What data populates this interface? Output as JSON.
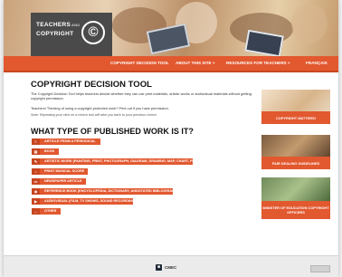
{
  "logo": {
    "line1": "TEACHERS",
    "and": "AND",
    "line2": "COPYRIGHT",
    "symbol": "©"
  },
  "nav": {
    "items": [
      {
        "label": "COPYRIGHT DECISION TOOL"
      },
      {
        "label": "ABOUT THIS SITE +"
      },
      {
        "label": "RESOURCES FOR TEACHERS +"
      },
      {
        "label": "FRANÇAIS"
      }
    ]
  },
  "main": {
    "title": "COPYRIGHT DECISION TOOL",
    "intro": "The Copyright Decision Tool helps teachers decide whether they can use print materials, artistic works or audiovisual materials without getting copyright permission.",
    "ask": "Teachers! Thinking of using a copyright-protected work? Print out if you have permission.",
    "note": "Note: Repeating your click on a choice tool will take you back to your previous choice.",
    "question": "WHAT TYPE OF PUBLISHED WORK IS IT?",
    "options": [
      {
        "icon": "≡",
        "icon_name": "article-icon",
        "label": "ARTICLE FROM A PERIODICAL"
      },
      {
        "icon": "▤",
        "icon_name": "book-icon",
        "label": "BOOK"
      },
      {
        "icon": "✎",
        "icon_name": "artistic-icon",
        "label": "ARTISTIC WORK (PAINTING, PRINT, PHOTOGRAPH, DIAGRAM, DRAWING, MAP, CHART, PLAN)"
      },
      {
        "icon": "♪",
        "icon_name": "music-icon",
        "label": "PRINT MUSICAL SCORE"
      },
      {
        "icon": "▭",
        "icon_name": "newspaper-icon",
        "label": "NEWSPAPER ARTICLE"
      },
      {
        "icon": "◆",
        "icon_name": "reference-icon",
        "label": "REFERENCE BOOK (ENCYCLOPEDIA, DICTIONARY, ANNOTATED BIBLIOGRAPHY)"
      },
      {
        "icon": "▶",
        "icon_name": "audiovisual-icon",
        "label": "AUDIOVISUAL (FILM, TV SHOWS, SOUND RECORDING)"
      },
      {
        "icon": "…",
        "icon_name": "other-icon",
        "label": "OTHER"
      }
    ]
  },
  "sidebar": {
    "panels": [
      {
        "label": "COPYRIGHT MATTERS!"
      },
      {
        "label": "FAIR DEALING GUIDELINES"
      },
      {
        "label": "MINISTER OF EDUCATION COPYRIGHT OFFICERS"
      }
    ]
  },
  "footer": {
    "org": "CMEC",
    "org_icon": "■"
  },
  "colors": {
    "accent": "#e2582f",
    "accent_dark": "#c8461f",
    "logo_bg": "#4a4a4a"
  }
}
